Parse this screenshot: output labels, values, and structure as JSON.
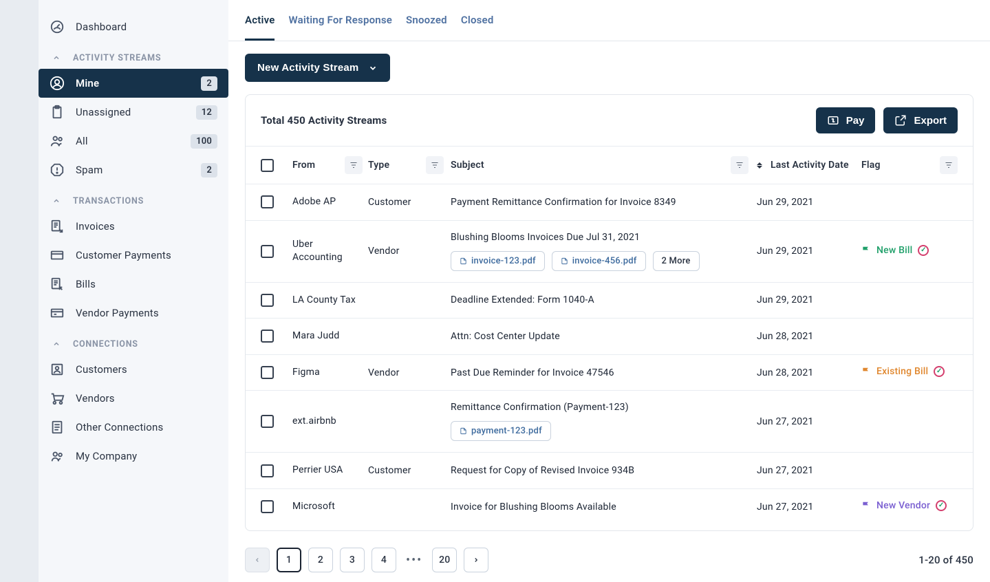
{
  "sidebar": {
    "dashboard": "Dashboard",
    "groups": [
      {
        "title": "ACTIVITY STREAMS",
        "items": [
          {
            "label": "Mine",
            "badge": "2",
            "icon": "user-circle-icon",
            "active": true
          },
          {
            "label": "Unassigned",
            "badge": "12",
            "icon": "clipboard-icon"
          },
          {
            "label": "All",
            "badge": "100",
            "icon": "people-icon"
          },
          {
            "label": "Spam",
            "badge": "2",
            "icon": "warning-hex-icon"
          }
        ]
      },
      {
        "title": "TRANSACTIONS",
        "items": [
          {
            "label": "Invoices",
            "icon": "invoice-out-icon"
          },
          {
            "label": "Customer Payments",
            "icon": "payment-in-icon"
          },
          {
            "label": "Bills",
            "icon": "invoice-in-icon"
          },
          {
            "label": "Vendor Payments",
            "icon": "payment-out-icon"
          }
        ]
      },
      {
        "title": "CONNECTIONS",
        "items": [
          {
            "label": "Customers",
            "icon": "customers-icon"
          },
          {
            "label": "Vendors",
            "icon": "vendors-icon"
          },
          {
            "label": "Other Connections",
            "icon": "doc-list-icon"
          },
          {
            "label": "My Company",
            "icon": "company-icon"
          }
        ]
      }
    ]
  },
  "tabs": [
    {
      "label": "Active",
      "active": true
    },
    {
      "label": "Waiting For Response"
    },
    {
      "label": "Snoozed"
    },
    {
      "label": "Closed"
    }
  ],
  "toolbar": {
    "new_stream_label": "New Activity Stream"
  },
  "panel": {
    "title": "Total 450 Activity Streams",
    "pay_label": "Pay",
    "export_label": "Export"
  },
  "columns": {
    "from": "From",
    "type": "Type",
    "subject": "Subject",
    "last_activity": "Last Activity Date",
    "flag": "Flag"
  },
  "rows": [
    {
      "from": "Adobe AP",
      "type": "Customer",
      "subject": "Payment Remittance Confirmation for Invoice 8349",
      "date": "Jun 29, 2021"
    },
    {
      "from": "Uber Accounting",
      "type": "Vendor",
      "subject": "Blushing Blooms Invoices Due Jul 31, 2021",
      "date": "Jun 29, 2021",
      "attachments": [
        "invoice-123.pdf",
        "invoice-456.pdf"
      ],
      "more": "2 More",
      "flag": {
        "label": "New Bill",
        "color": "green"
      }
    },
    {
      "from": "LA County Tax",
      "type": "",
      "subject": "Deadline Extended: Form 1040-A",
      "date": "Jun 29, 2021"
    },
    {
      "from": "Mara Judd",
      "type": "",
      "subject": "Attn: Cost Center Update",
      "date": "Jun 28, 2021"
    },
    {
      "from": "Figma",
      "type": "Vendor",
      "subject": "Past Due Reminder for Invoice 47546",
      "date": "Jun 28, 2021",
      "flag": {
        "label": "Existing Bill",
        "color": "orange"
      }
    },
    {
      "from": "ext.airbnb",
      "type": "",
      "subject": "Remittance Confirmation (Payment-123)",
      "date": "Jun 27, 2021",
      "attachments": [
        "payment-123.pdf"
      ]
    },
    {
      "from": "Perrier USA",
      "type": "Customer",
      "subject": "Request for Copy of Revised Invoice 934B",
      "date": "Jun 27, 2021"
    },
    {
      "from": "Microsoft",
      "type": "",
      "subject": "Invoice for Blushing Blooms Available",
      "date": "Jun 27, 2021",
      "flag": {
        "label": "New Vendor",
        "color": "purple"
      }
    }
  ],
  "pagination": {
    "pages": [
      "1",
      "2",
      "3",
      "4"
    ],
    "ellipsis": "•••",
    "last": "20",
    "range": "1-20 of 450"
  }
}
